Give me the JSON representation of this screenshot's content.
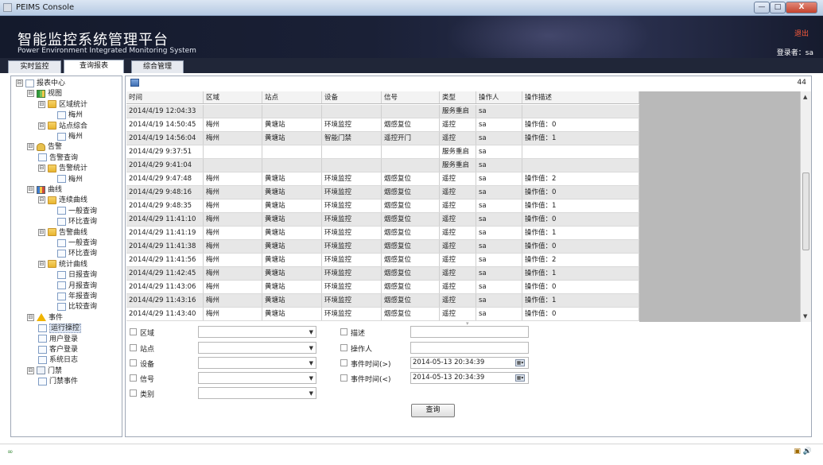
{
  "window": {
    "title": "PEIMS Console",
    "minimize_glyph": "—",
    "maximize_glyph": "□",
    "close_glyph": "X"
  },
  "banner": {
    "title_cn": "智能监控系统管理平台",
    "title_en": "Power Environment Integrated Monitoring System",
    "logout": "退出",
    "login_user": "登录者：sa"
  },
  "tabs": [
    "实时监控",
    "查询报表",
    "综合管理"
  ],
  "active_tab": "查询报表",
  "tree": [
    {
      "label": "报表中心",
      "level": 0,
      "icon": "report-center-icon",
      "expand": "⊟"
    },
    {
      "label": "视图",
      "level": 1,
      "icon": "view-icon",
      "expand": "⊟"
    },
    {
      "label": "区域统计",
      "level": 2,
      "icon": "folder-icon",
      "expand": "⊟"
    },
    {
      "label": "梅州",
      "level": 3,
      "icon": "page-icon",
      "expand": ""
    },
    {
      "label": "站点综合",
      "level": 2,
      "icon": "folder-icon",
      "expand": "⊟"
    },
    {
      "label": "梅州",
      "level": 3,
      "icon": "page-icon",
      "expand": ""
    },
    {
      "label": "告警",
      "level": 1,
      "icon": "alarm-icon",
      "expand": "⊟"
    },
    {
      "label": "告警查询",
      "level": 2,
      "icon": "page-icon",
      "expand": ""
    },
    {
      "label": "告警统计",
      "level": 2,
      "icon": "folder-icon",
      "expand": "⊟"
    },
    {
      "label": "梅州",
      "level": 3,
      "icon": "page-icon",
      "expand": ""
    },
    {
      "label": "曲线",
      "level": 1,
      "icon": "chart-icon",
      "expand": "⊟"
    },
    {
      "label": "连续曲线",
      "level": 2,
      "icon": "folder-icon",
      "expand": "⊟"
    },
    {
      "label": "一般查询",
      "level": 3,
      "icon": "page-icon",
      "expand": ""
    },
    {
      "label": "环比查询",
      "level": 3,
      "icon": "page-icon",
      "expand": ""
    },
    {
      "label": "告警曲线",
      "level": 2,
      "icon": "folder-icon",
      "expand": "⊟"
    },
    {
      "label": "一般查询",
      "level": 3,
      "icon": "page-icon",
      "expand": ""
    },
    {
      "label": "环比查询",
      "level": 3,
      "icon": "page-icon",
      "expand": ""
    },
    {
      "label": "统计曲线",
      "level": 2,
      "icon": "folder-icon",
      "expand": "⊟"
    },
    {
      "label": "日报查询",
      "level": 3,
      "icon": "page-icon",
      "expand": ""
    },
    {
      "label": "月报查询",
      "level": 3,
      "icon": "page-icon",
      "expand": ""
    },
    {
      "label": "年报查询",
      "level": 3,
      "icon": "page-icon",
      "expand": ""
    },
    {
      "label": "比较查询",
      "level": 3,
      "icon": "page-icon",
      "expand": ""
    },
    {
      "label": "事件",
      "level": 1,
      "icon": "event-warning-icon",
      "expand": "⊟"
    },
    {
      "label": "运行操控",
      "level": 2,
      "icon": "page-icon",
      "expand": "",
      "selected": true
    },
    {
      "label": "用户登录",
      "level": 2,
      "icon": "page-icon",
      "expand": ""
    },
    {
      "label": "客户登录",
      "level": 2,
      "icon": "page-icon",
      "expand": ""
    },
    {
      "label": "系统日志",
      "level": 2,
      "icon": "page-icon",
      "expand": ""
    },
    {
      "label": "门禁",
      "level": 1,
      "icon": "door-icon",
      "expand": "⊟"
    },
    {
      "label": "门禁事件",
      "level": 2,
      "icon": "page-icon",
      "expand": ""
    }
  ],
  "main": {
    "page_count": "44"
  },
  "grid": {
    "columns": [
      "时间",
      "区域",
      "站点",
      "设备",
      "信号",
      "类型",
      "操作人",
      "操作描述"
    ],
    "rows": [
      [
        "2014/4/19 12:04:33",
        "",
        "",
        "",
        "",
        "服务重启",
        "sa",
        ""
      ],
      [
        "2014/4/19 14:50:45",
        "梅州",
        "黄塘站",
        "环境监控",
        "烟感复位",
        "遥控",
        "sa",
        "操作值：0"
      ],
      [
        "2014/4/19 14:56:04",
        "梅州",
        "黄塘站",
        "智能门禁",
        "遥控开门",
        "遥控",
        "sa",
        "操作值：1"
      ],
      [
        "2014/4/29 9:37:51",
        "",
        "",
        "",
        "",
        "服务重启",
        "sa",
        ""
      ],
      [
        "2014/4/29 9:41:04",
        "",
        "",
        "",
        "",
        "服务重启",
        "sa",
        ""
      ],
      [
        "2014/4/29 9:47:48",
        "梅州",
        "黄塘站",
        "环境监控",
        "烟感复位",
        "遥控",
        "sa",
        "操作值：2"
      ],
      [
        "2014/4/29 9:48:16",
        "梅州",
        "黄塘站",
        "环境监控",
        "烟感复位",
        "遥控",
        "sa",
        "操作值：0"
      ],
      [
        "2014/4/29 9:48:35",
        "梅州",
        "黄塘站",
        "环境监控",
        "烟感复位",
        "遥控",
        "sa",
        "操作值：1"
      ],
      [
        "2014/4/29 11:41:10",
        "梅州",
        "黄塘站",
        "环境监控",
        "烟感复位",
        "遥控",
        "sa",
        "操作值：0"
      ],
      [
        "2014/4/29 11:41:19",
        "梅州",
        "黄塘站",
        "环境监控",
        "烟感复位",
        "遥控",
        "sa",
        "操作值：1"
      ],
      [
        "2014/4/29 11:41:38",
        "梅州",
        "黄塘站",
        "环境监控",
        "烟感复位",
        "遥控",
        "sa",
        "操作值：0"
      ],
      [
        "2014/4/29 11:41:56",
        "梅州",
        "黄塘站",
        "环境监控",
        "烟感复位",
        "遥控",
        "sa",
        "操作值：2"
      ],
      [
        "2014/4/29 11:42:45",
        "梅州",
        "黄塘站",
        "环境监控",
        "烟感复位",
        "遥控",
        "sa",
        "操作值：1"
      ],
      [
        "2014/4/29 11:43:06",
        "梅州",
        "黄塘站",
        "环境监控",
        "烟感复位",
        "遥控",
        "sa",
        "操作值：0"
      ],
      [
        "2014/4/29 11:43:16",
        "梅州",
        "黄塘站",
        "环境监控",
        "烟感复位",
        "遥控",
        "sa",
        "操作值：1"
      ],
      [
        "2014/4/29 11:43:40",
        "梅州",
        "黄塘站",
        "环境监控",
        "烟感复位",
        "遥控",
        "sa",
        "操作值：0"
      ]
    ]
  },
  "filters": {
    "area": "区域",
    "site": "站点",
    "device": "设备",
    "signal": "信号",
    "category": "类别",
    "description": "描述",
    "operator": "操作人",
    "event_time_from": "事件时间(>)",
    "event_time_to": "事件时间(<)",
    "time_from_value": "2014-05-13 20:34:39",
    "time_to_value": "2014-05-13 20:34:39",
    "query_button": "查询"
  },
  "status": {
    "connection_icon": "∞",
    "tray": "▣ 🔊"
  }
}
